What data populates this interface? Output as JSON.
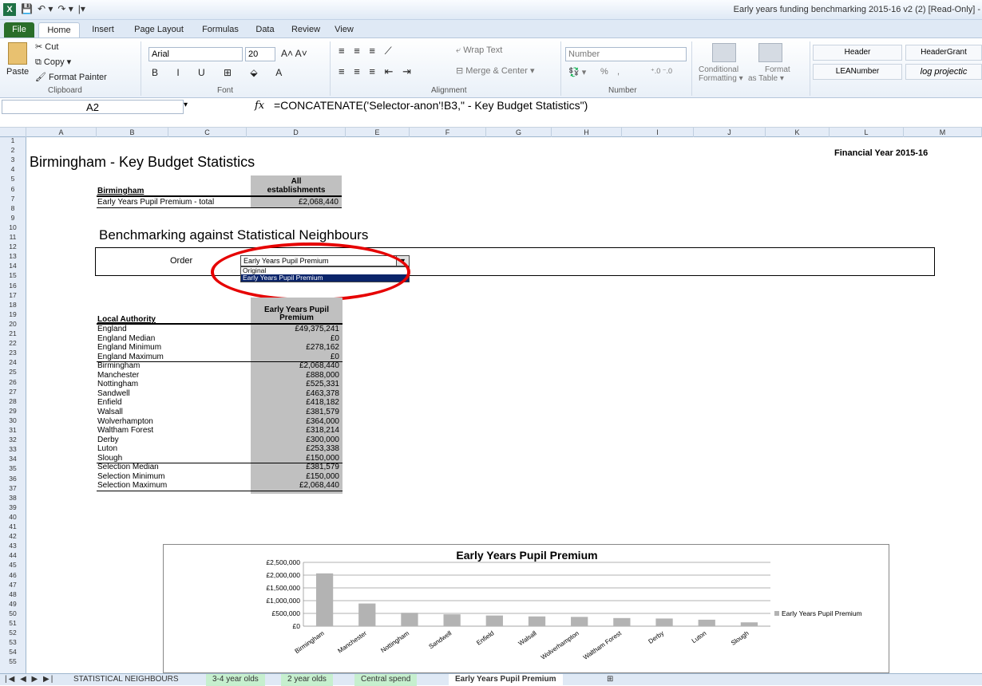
{
  "window": {
    "title": "Early years funding benchmarking 2015-16 v2 (2)  [Read-Only]  -",
    "quick_access": [
      "X",
      "💾",
      "↶ ▾",
      "↷ ▾",
      "|▾"
    ]
  },
  "ribbon_tabs": [
    "File",
    "Home",
    "Insert",
    "Page Layout",
    "Formulas",
    "Data",
    "Review",
    "View"
  ],
  "ribbon": {
    "clipboard": {
      "paste": "Paste",
      "cut": "Cut",
      "copy": "Copy ▾",
      "format_painter": "Format Painter",
      "label": "Clipboard"
    },
    "font": {
      "name": "Arial",
      "size": "20",
      "label": "Font"
    },
    "alignment": {
      "wrap_text": "Wrap Text",
      "merge_center": "Merge & Center ▾",
      "label": "Alignment"
    },
    "number": {
      "format": "Number",
      "label": "Number",
      "percent": "%",
      "comma": ","
    },
    "styles": {
      "conditional": "Conditional",
      "formatting": "Formatting ▾",
      "format": "Format",
      "as_table": "as Table ▾",
      "boxes": [
        "Header",
        "HeaderGrant",
        "LEANumber",
        "log projectic"
      ]
    }
  },
  "formula_bar": {
    "name_box": "A2",
    "fx": "fx",
    "formula": "=CONCATENATE('Selector-anon'!B3,\" - Key Budget Statistics\")"
  },
  "columns": [
    "A",
    "B",
    "C",
    "D",
    "E",
    "F",
    "G",
    "H",
    "I",
    "J",
    "K",
    "L",
    "M"
  ],
  "rows": [
    "1",
    "2",
    "3",
    "4",
    "5",
    "6",
    "7",
    "8",
    "9",
    "10",
    "11",
    "12",
    "13",
    "14",
    "15",
    "16",
    "17",
    "18",
    "19",
    "20",
    "21",
    "22",
    "23",
    "24",
    "25",
    "26",
    "27",
    "28",
    "29",
    "30",
    "31",
    "32",
    "33",
    "34",
    "35",
    "36",
    "37",
    "38",
    "39",
    "40",
    "41",
    "42",
    "43",
    "44",
    "45",
    "46",
    "47",
    "48",
    "49",
    "50",
    "51",
    "52",
    "53",
    "54",
    "55"
  ],
  "sheet": {
    "title": "Birmingham - Key Budget Statistics",
    "financial_year": "Financial Year 2015-16",
    "kbs": {
      "la_label": "Birmingham",
      "col_header_1": "All",
      "col_header_2": "establishments",
      "row_label": "Early Years Pupil Premium - total",
      "row_value": "£2,068,440"
    },
    "bench_title": "Benchmarking against Statistical Neighbours",
    "order_label": "Order",
    "dropdown": {
      "selected": "Early Years Pupil Premium",
      "options": [
        "Original",
        "Early Years Pupil Premium"
      ]
    },
    "table": {
      "header_la": "Local Authority",
      "header_val_1": "Early Years Pupil",
      "header_val_2": "Premium",
      "rows": [
        [
          "England",
          "£49,375,241"
        ],
        [
          "England Median",
          "£0"
        ],
        [
          "England Minimum",
          "£278,162"
        ],
        [
          "England Maximum",
          "£0"
        ],
        [
          "Birmingham",
          "£2,068,440"
        ],
        [
          "Manchester",
          "£888,000"
        ],
        [
          "Nottingham",
          "£525,331"
        ],
        [
          "Sandwell",
          "£463,378"
        ],
        [
          "Enfield",
          "£418,182"
        ],
        [
          "Walsall",
          "£381,579"
        ],
        [
          "Wolverhampton",
          "£364,000"
        ],
        [
          "Waltham Forest",
          "£318,214"
        ],
        [
          "Derby",
          "£300,000"
        ],
        [
          "Luton",
          "£253,338"
        ],
        [
          "Slough",
          "£150,000"
        ],
        [
          "Selection Median",
          "£381,579"
        ],
        [
          "Selection Minimum",
          "£150,000"
        ],
        [
          "Selection Maximum",
          "£2,068,440"
        ]
      ]
    }
  },
  "chart_data": {
    "type": "bar",
    "title": "Early Years Pupil Premium",
    "categories": [
      "Birmingham",
      "Manchester",
      "Nottingham",
      "Sandwell",
      "Enfield",
      "Walsall",
      "Wolverhampton",
      "Waltham Forest",
      "Derby",
      "Luton",
      "Slough"
    ],
    "series": [
      {
        "name": "Early Years Pupil Premium",
        "values": [
          2068440,
          888000,
          525331,
          463378,
          418182,
          381579,
          364000,
          318214,
          300000,
          253338,
          150000
        ]
      }
    ],
    "ylim": [
      0,
      2500000
    ],
    "yticks": [
      "£2,500,000",
      "£2,000,000",
      "£1,500,000",
      "£1,000,000",
      "£500,000",
      "£0"
    ],
    "grid": true,
    "legend": "right",
    "bar_color": "#b3b3b3"
  },
  "sheet_tabs": [
    "STATISTICAL NEIGHBOURS",
    "3-4 year olds",
    "2 year olds",
    "Central spend",
    "Early Years Pupil Premium"
  ],
  "nav_arrows": "|◀ ◀ ▶ ▶|"
}
